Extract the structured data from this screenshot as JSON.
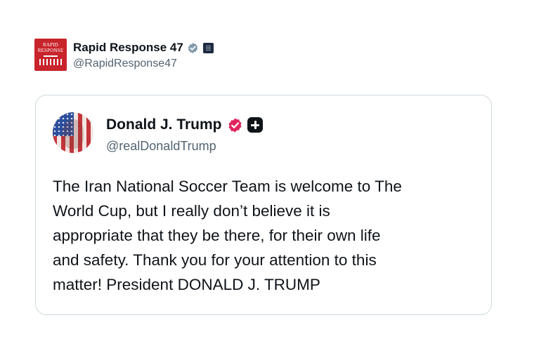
{
  "account": {
    "name": "Rapid Response 47",
    "handle": "@RapidResponse47",
    "avatar_text": [
      "RAPID",
      "RESPONSE"
    ],
    "verified_icon": "verified-badge-gray-icon",
    "affiliate_icon": "affiliate-badge-icon"
  },
  "quoted_post": {
    "author_name": "Donald J. Trump",
    "author_handle": "@realDonaldTrump",
    "verified_icon": "verified-badge-pink-icon",
    "subscriber_icon": "plus-badge-icon",
    "text": "The Iran National Soccer Team is welcome to The\nWorld Cup, but I really don’t believe it is\nappropriate that they be there, for their own life\nand safety. Thank you for your attention to this\nmatter! President DONALD J. TRUMP"
  },
  "colors": {
    "brand_red": "#c8242b",
    "verified_gray": "#829aab",
    "verified_pink": "#e0245e",
    "border": "#cfd9de",
    "secondary_text": "#536471"
  }
}
